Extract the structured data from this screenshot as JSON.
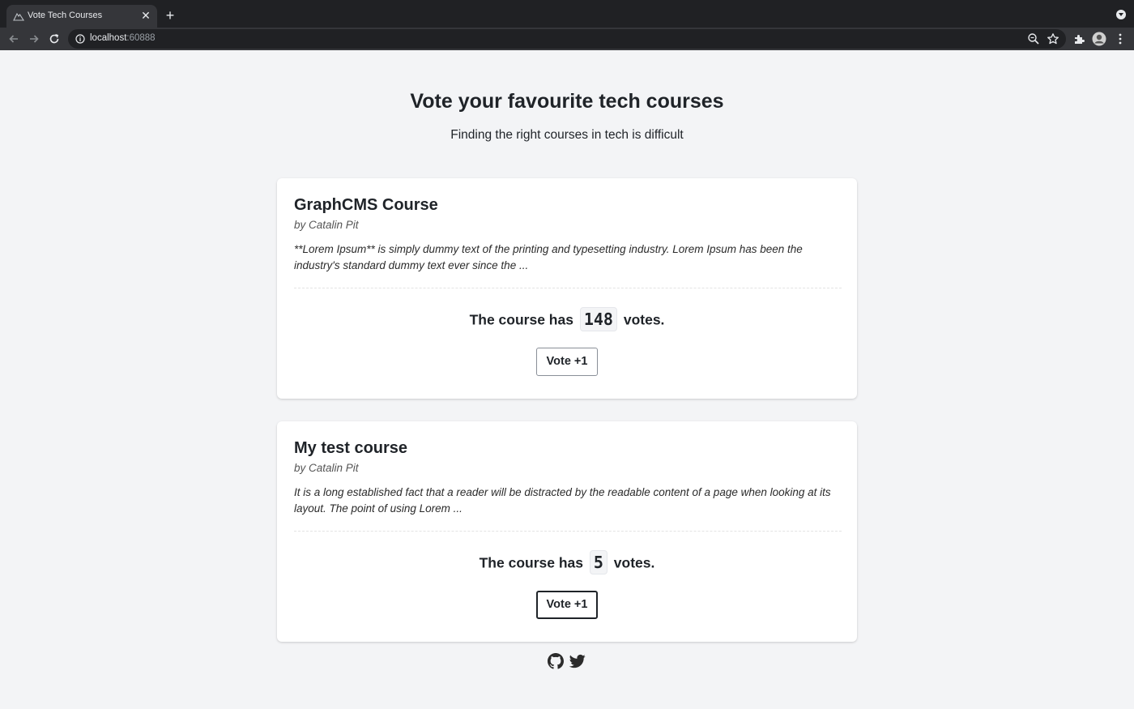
{
  "browser": {
    "tab_title": "Vote Tech Courses",
    "url_host": "localhost",
    "url_port": ":60888",
    "icons": [
      "nuxt-favicon-icon",
      "close-icon",
      "plus-icon",
      "back-icon",
      "forward-icon",
      "reload-icon",
      "info-icon",
      "zoom-icon",
      "star-icon",
      "extensions-icon",
      "profile-avatar-icon",
      "kebab-menu-icon",
      "tab-search-icon"
    ]
  },
  "hero": {
    "title_pre": "Vote ",
    "title_bold": "your favourite",
    "title_post": " tech courses",
    "subtitle": "Finding the right courses in tech is difficult"
  },
  "courses": [
    {
      "title": "GraphCMS Course",
      "author": "by Catalin Pit",
      "description": "**Lorem Ipsum** is simply dummy text of the printing and typesetting industry. Lorem Ipsum has been the industry's standard dummy text ever since the ...",
      "votes_prefix": "The course has",
      "votes": "148",
      "votes_suffix": "votes.",
      "button_label": "Vote +1"
    },
    {
      "title": "My test course",
      "author": "by Catalin Pit",
      "description": "It is a long established fact that a reader will be distracted by the readable content of a page when looking at its layout. The point of using Lorem ...",
      "votes_prefix": "The course has",
      "votes": "5",
      "votes_suffix": "votes.",
      "button_label": "Vote +1"
    }
  ],
  "footer": {
    "icons": [
      "github-icon",
      "twitter-icon"
    ]
  },
  "colors": {
    "page_background": "#f3f4f6",
    "card_background": "#ffffff",
    "text": "#1f2328",
    "chrome_dark": "#202124",
    "chrome_toolbar": "#35363a"
  }
}
